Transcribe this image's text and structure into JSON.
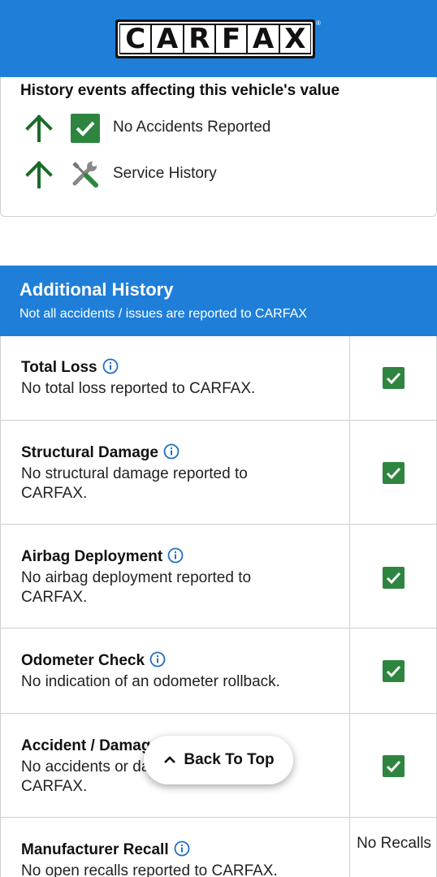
{
  "header": {
    "logo_letters": [
      "C",
      "A",
      "R",
      "F",
      "A",
      "X"
    ],
    "brand_color": "#1f7fd8"
  },
  "history_events": {
    "title": "History events affecting this vehicle's value",
    "items": [
      {
        "label": "No Accidents Reported",
        "icon": "checkmark-icon",
        "trend": "up-arrow-icon"
      },
      {
        "label": "Service History",
        "icon": "wrench-screwdriver-icon",
        "trend": "up-arrow-icon"
      }
    ]
  },
  "additional_history": {
    "title": "Additional History",
    "subtitle": "Not all accidents / issues are reported to CARFAX",
    "rows": [
      {
        "title": "Total Loss",
        "desc": "No total loss reported to CARFAX.",
        "status": "check"
      },
      {
        "title": "Structural Damage",
        "desc": "No structural damage reported to CARFAX.",
        "status": "check"
      },
      {
        "title": "Airbag Deployment",
        "desc": "No airbag deployment reported to CARFAX.",
        "status": "check"
      },
      {
        "title": "Odometer Check",
        "desc": "No indication of an odometer rollback.",
        "status": "check"
      },
      {
        "title": "Accident / Damage",
        "desc": "No accidents or damage reported to CARFAX.",
        "status": "check"
      },
      {
        "title": "Manufacturer Recall",
        "desc": "No open recalls reported to CARFAX.",
        "status": "text",
        "value": "No Recalls"
      }
    ]
  },
  "back_to_top": {
    "label": "Back To Top"
  },
  "colors": {
    "check_green": "#2e8540",
    "arrow_green": "#1b6b2c",
    "info_blue": "#1f6fc4"
  }
}
